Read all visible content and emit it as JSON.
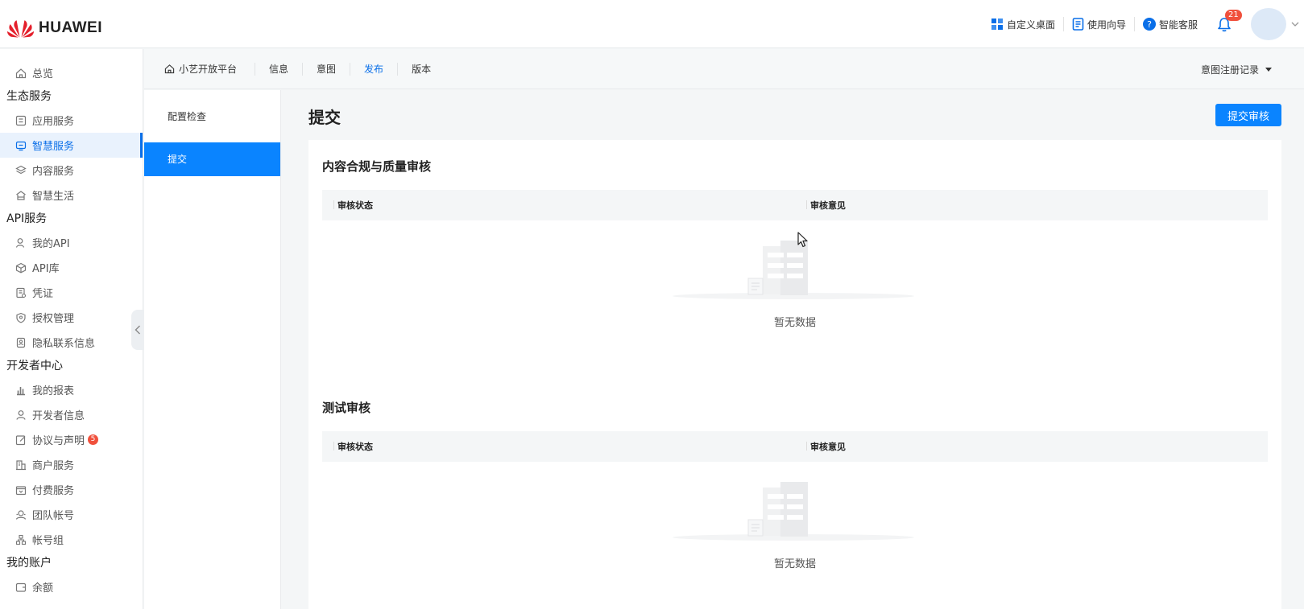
{
  "header": {
    "brand": "HUAWEI",
    "actions": [
      {
        "label": "自定义桌面",
        "icon": "dashboard-grid-icon"
      },
      {
        "label": "使用向导",
        "icon": "guide-book-icon"
      },
      {
        "label": "智能客服",
        "icon": "help-circle-icon"
      }
    ],
    "notification_count": "21",
    "colors": {
      "accent": "#0a84ff",
      "badge": "#f0503c"
    }
  },
  "sidebar": {
    "overview": "总览",
    "groups": [
      {
        "title": "生态服务",
        "items": [
          {
            "label": "应用服务",
            "icon": "app-icon"
          },
          {
            "label": "智慧服务",
            "icon": "smart-service-icon",
            "active": true
          },
          {
            "label": "内容服务",
            "icon": "layers-icon"
          },
          {
            "label": "智慧生活",
            "icon": "home-life-icon"
          }
        ]
      },
      {
        "title": "API服务",
        "items": [
          {
            "label": "我的API",
            "icon": "user-api-icon"
          },
          {
            "label": "API库",
            "icon": "cube-icon"
          },
          {
            "label": "凭证",
            "icon": "certificate-icon"
          },
          {
            "label": "授权管理",
            "icon": "shield-icon"
          },
          {
            "label": "隐私联系信息",
            "icon": "privacy-icon"
          }
        ]
      },
      {
        "title": "开发者中心",
        "items": [
          {
            "label": "我的报表",
            "icon": "bar-chart-icon"
          },
          {
            "label": "开发者信息",
            "icon": "person-icon"
          },
          {
            "label": "协议与声明",
            "icon": "edit-doc-icon",
            "badge": "5"
          },
          {
            "label": "商户服务",
            "icon": "merchant-icon"
          },
          {
            "label": "付费服务",
            "icon": "paid-service-icon"
          },
          {
            "label": "团队帐号",
            "icon": "team-icon"
          },
          {
            "label": "帐号组",
            "icon": "account-group-icon"
          }
        ]
      },
      {
        "title": "我的账户",
        "items": [
          {
            "label": "余额",
            "icon": "wallet-icon"
          }
        ]
      }
    ]
  },
  "subnav": {
    "home": "小艺开放平台",
    "tabs": [
      {
        "label": "信息"
      },
      {
        "label": "意图"
      },
      {
        "label": "发布",
        "active": true
      },
      {
        "label": "版本"
      }
    ],
    "right_dropdown": "意图注册记录"
  },
  "menu2": {
    "items": [
      {
        "label": "配置检查"
      },
      {
        "label": "提交",
        "active": true
      }
    ]
  },
  "main": {
    "title": "提交",
    "submit_button": "提交审核",
    "sections": [
      {
        "title": "内容合规与质量审核",
        "columns": [
          "审核状态",
          "审核意见"
        ],
        "empty_text": "暂无数据"
      },
      {
        "title": "测试审核",
        "columns": [
          "审核状态",
          "审核意见"
        ],
        "empty_text": "暂无数据"
      }
    ]
  }
}
